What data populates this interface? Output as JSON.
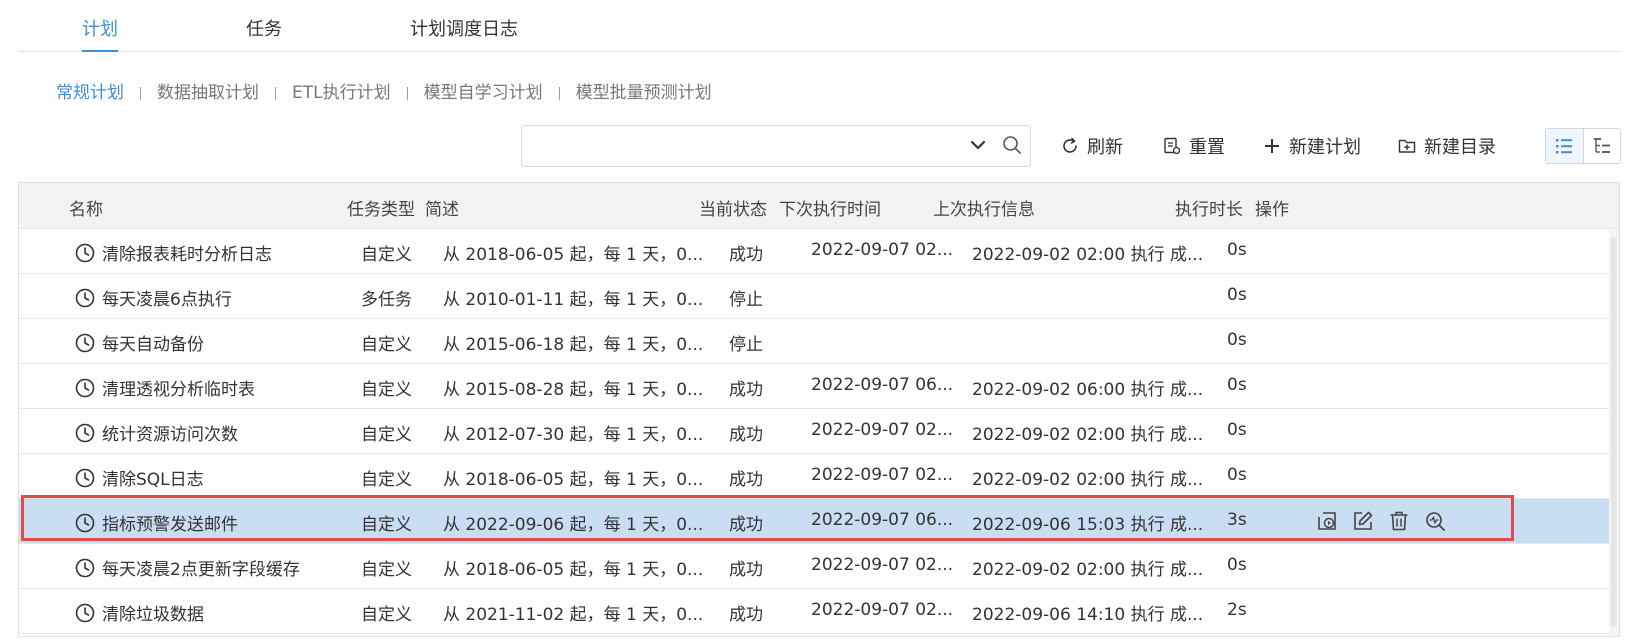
{
  "top_tabs": [
    {
      "label": "计划",
      "active": true
    },
    {
      "label": "任务",
      "active": false
    },
    {
      "label": "计划调度日志",
      "active": false
    }
  ],
  "sub_tabs": [
    {
      "label": "常规计划",
      "active": true
    },
    {
      "label": "数据抽取计划",
      "active": false
    },
    {
      "label": "ETL执行计划",
      "active": false
    },
    {
      "label": "模型自学习计划",
      "active": false
    },
    {
      "label": "模型批量预测计划",
      "active": false
    }
  ],
  "search": {
    "value": "",
    "placeholder": ""
  },
  "toolbar": {
    "refresh": "刷新",
    "reset": "重置",
    "new_plan": "新建计划",
    "new_dir": "新建目录"
  },
  "table": {
    "headers": {
      "name": "名称",
      "type": "任务类型",
      "desc": "简述",
      "state": "当前状态",
      "next": "下次执行时间",
      "last": "上次执行信息",
      "duration": "执行时长",
      "ops": "操作"
    },
    "rows": [
      {
        "name": "清除报表耗时分析日志",
        "type": "自定义",
        "desc": "从 2018-06-05 起，每 1 天，0...",
        "state": "成功",
        "next": "2022-09-07 02...",
        "last": "2022-09-02 02:00 执行 成...",
        "duration": "0s"
      },
      {
        "name": "每天凌晨6点执行",
        "type": "多任务",
        "desc": "从 2010-01-11 起，每 1 天，0...",
        "state": "停止",
        "next": "",
        "last": "",
        "duration": "0s"
      },
      {
        "name": "每天自动备份",
        "type": "自定义",
        "desc": "从 2015-06-18 起，每 1 天，0...",
        "state": "停止",
        "next": "",
        "last": "",
        "duration": "0s"
      },
      {
        "name": "清理透视分析临时表",
        "type": "自定义",
        "desc": "从 2015-08-28 起，每 1 天，0...",
        "state": "成功",
        "next": "2022-09-07 06...",
        "last": "2022-09-02 06:00 执行 成...",
        "duration": "0s"
      },
      {
        "name": "统计资源访问次数",
        "type": "自定义",
        "desc": "从 2012-07-30 起，每 1 天，0...",
        "state": "成功",
        "next": "2022-09-07 02...",
        "last": "2022-09-02 02:00 执行 成...",
        "duration": "0s"
      },
      {
        "name": "清除SQL日志",
        "type": "自定义",
        "desc": "从 2018-06-05 起，每 1 天，0...",
        "state": "成功",
        "next": "2022-09-07 02...",
        "last": "2022-09-02 02:00 执行 成...",
        "duration": "0s"
      },
      {
        "name": "指标预警发送邮件",
        "type": "自定义",
        "desc": "从 2022-09-06 起，每 1 天，0...",
        "state": "成功",
        "next": "2022-09-07 06...",
        "last": "2022-09-06 15:03 执行 成...",
        "duration": "3s",
        "selected": true
      },
      {
        "name": "每天凌晨2点更新字段缓存",
        "type": "自定义",
        "desc": "从 2018-06-05 起，每 1 天，0...",
        "state": "成功",
        "next": "2022-09-07 02...",
        "last": "2022-09-02 02:00 执行 成...",
        "duration": "0s"
      },
      {
        "name": "清除垃圾数据",
        "type": "自定义",
        "desc": "从 2021-11-02 起，每 1 天，0...",
        "state": "成功",
        "next": "2022-09-07 02...",
        "last": "2022-09-06 14:10 执行 成...",
        "duration": "2s"
      }
    ]
  },
  "colors": {
    "accent": "#3e8ed8",
    "selected_row": "#c9ddf3",
    "highlight": "#e34a4a"
  },
  "icons": [
    "chevron-down-icon",
    "search-icon",
    "refresh-icon",
    "reset-icon",
    "plus-icon",
    "new-folder-icon",
    "list-view-icon",
    "tree-view-icon",
    "clock-icon",
    "run-icon",
    "edit-icon",
    "delete-icon",
    "log-icon"
  ]
}
